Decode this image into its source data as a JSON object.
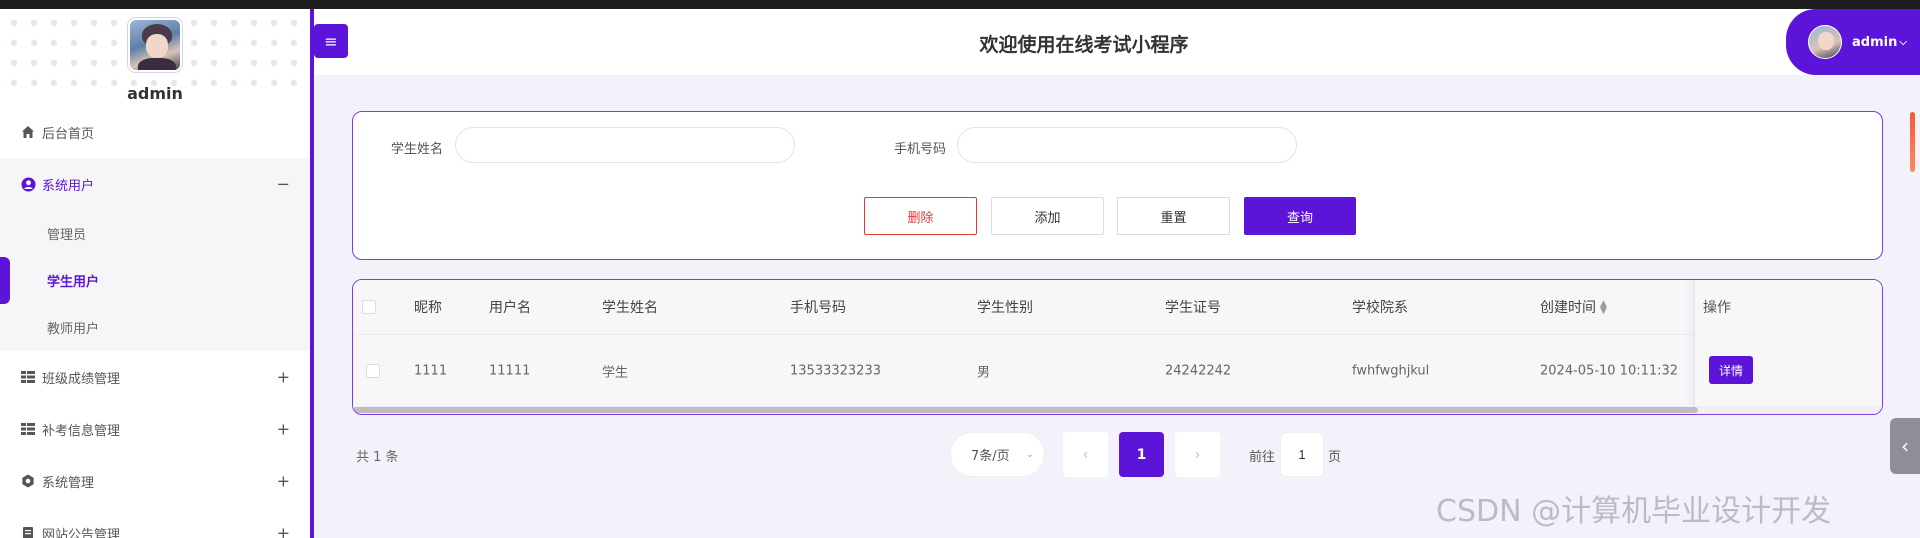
{
  "sidebar": {
    "username": "admin",
    "menu": [
      {
        "label": "后台首页",
        "icon": "home-icon"
      },
      {
        "label": "系统用户",
        "icon": "user-circle-icon",
        "toggle": "−",
        "children": [
          "管理员",
          "学生用户",
          "教师用户"
        ],
        "active_child": 1
      },
      {
        "label": "班级成绩管理",
        "icon": "grid-icon",
        "toggle": "+"
      },
      {
        "label": "补考信息管理",
        "icon": "grid-icon",
        "toggle": "+"
      },
      {
        "label": "系统管理",
        "icon": "gear-icon",
        "toggle": "+"
      },
      {
        "label": "网站公告管理",
        "icon": "doc-icon",
        "toggle": "+"
      }
    ]
  },
  "header": {
    "menu_toggle_icon": "≡",
    "title": "欢迎使用在线考试小程序",
    "user": "admin"
  },
  "search": {
    "name_label": "学生姓名",
    "name_value": "",
    "phone_label": "手机号码",
    "phone_value": "",
    "buttons": {
      "delete": "删除",
      "add": "添加",
      "reset": "重置",
      "query": "查询"
    }
  },
  "table": {
    "columns": [
      "昵称",
      "用户名",
      "学生姓名",
      "手机号码",
      "学生性别",
      "学生证号",
      "学校院系",
      "创建时间",
      "操作"
    ],
    "rows": [
      {
        "nickname": "1111",
        "username": "11111",
        "name": "学生",
        "phone": "13533323233",
        "gender": "男",
        "student_id": "24242242",
        "department": "fwhfwghjkul",
        "created": "2024-05-10 10:11:32",
        "action": "详情"
      }
    ]
  },
  "pagination": {
    "total": "共 1 条",
    "page_size": "7条/页",
    "prev": "‹",
    "current": "1",
    "next": "›",
    "goto_label": "前往",
    "goto_value": "1",
    "page_suffix": "页"
  },
  "watermark": "CSDN @计算机毕业设计开发",
  "colors": {
    "accent": "#5b14d8",
    "danger": "#e03a3a"
  }
}
